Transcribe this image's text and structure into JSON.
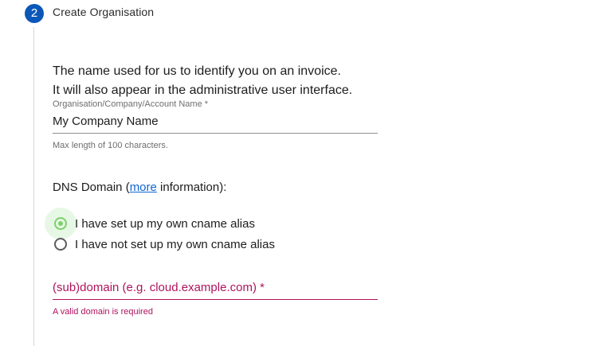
{
  "step": {
    "number": "2",
    "title": "Create Organisation"
  },
  "intro": {
    "line1": "The name used for us to identify you on an invoice.",
    "line2": "It will also appear in the administrative user interface."
  },
  "org_name_field": {
    "label": "Organisation/Company/Account Name *",
    "value": "My Company Name",
    "hint": "Max length of 100 characters."
  },
  "dns": {
    "label_prefix": "DNS Domain (",
    "link_text": "more",
    "label_suffix": " information):",
    "options": [
      {
        "label": "I have set up my own cname alias",
        "checked": true
      },
      {
        "label": "I have not set up my own cname alias",
        "checked": false
      }
    ]
  },
  "domain_field": {
    "placeholder": "(sub)domain (e.g. cloud.example.com) *",
    "error": "A valid domain is required"
  },
  "colors": {
    "step_badge": "#0b57b8",
    "link": "#1266d4",
    "radio_checked": "#7ad36a",
    "error": "#b0135e"
  }
}
